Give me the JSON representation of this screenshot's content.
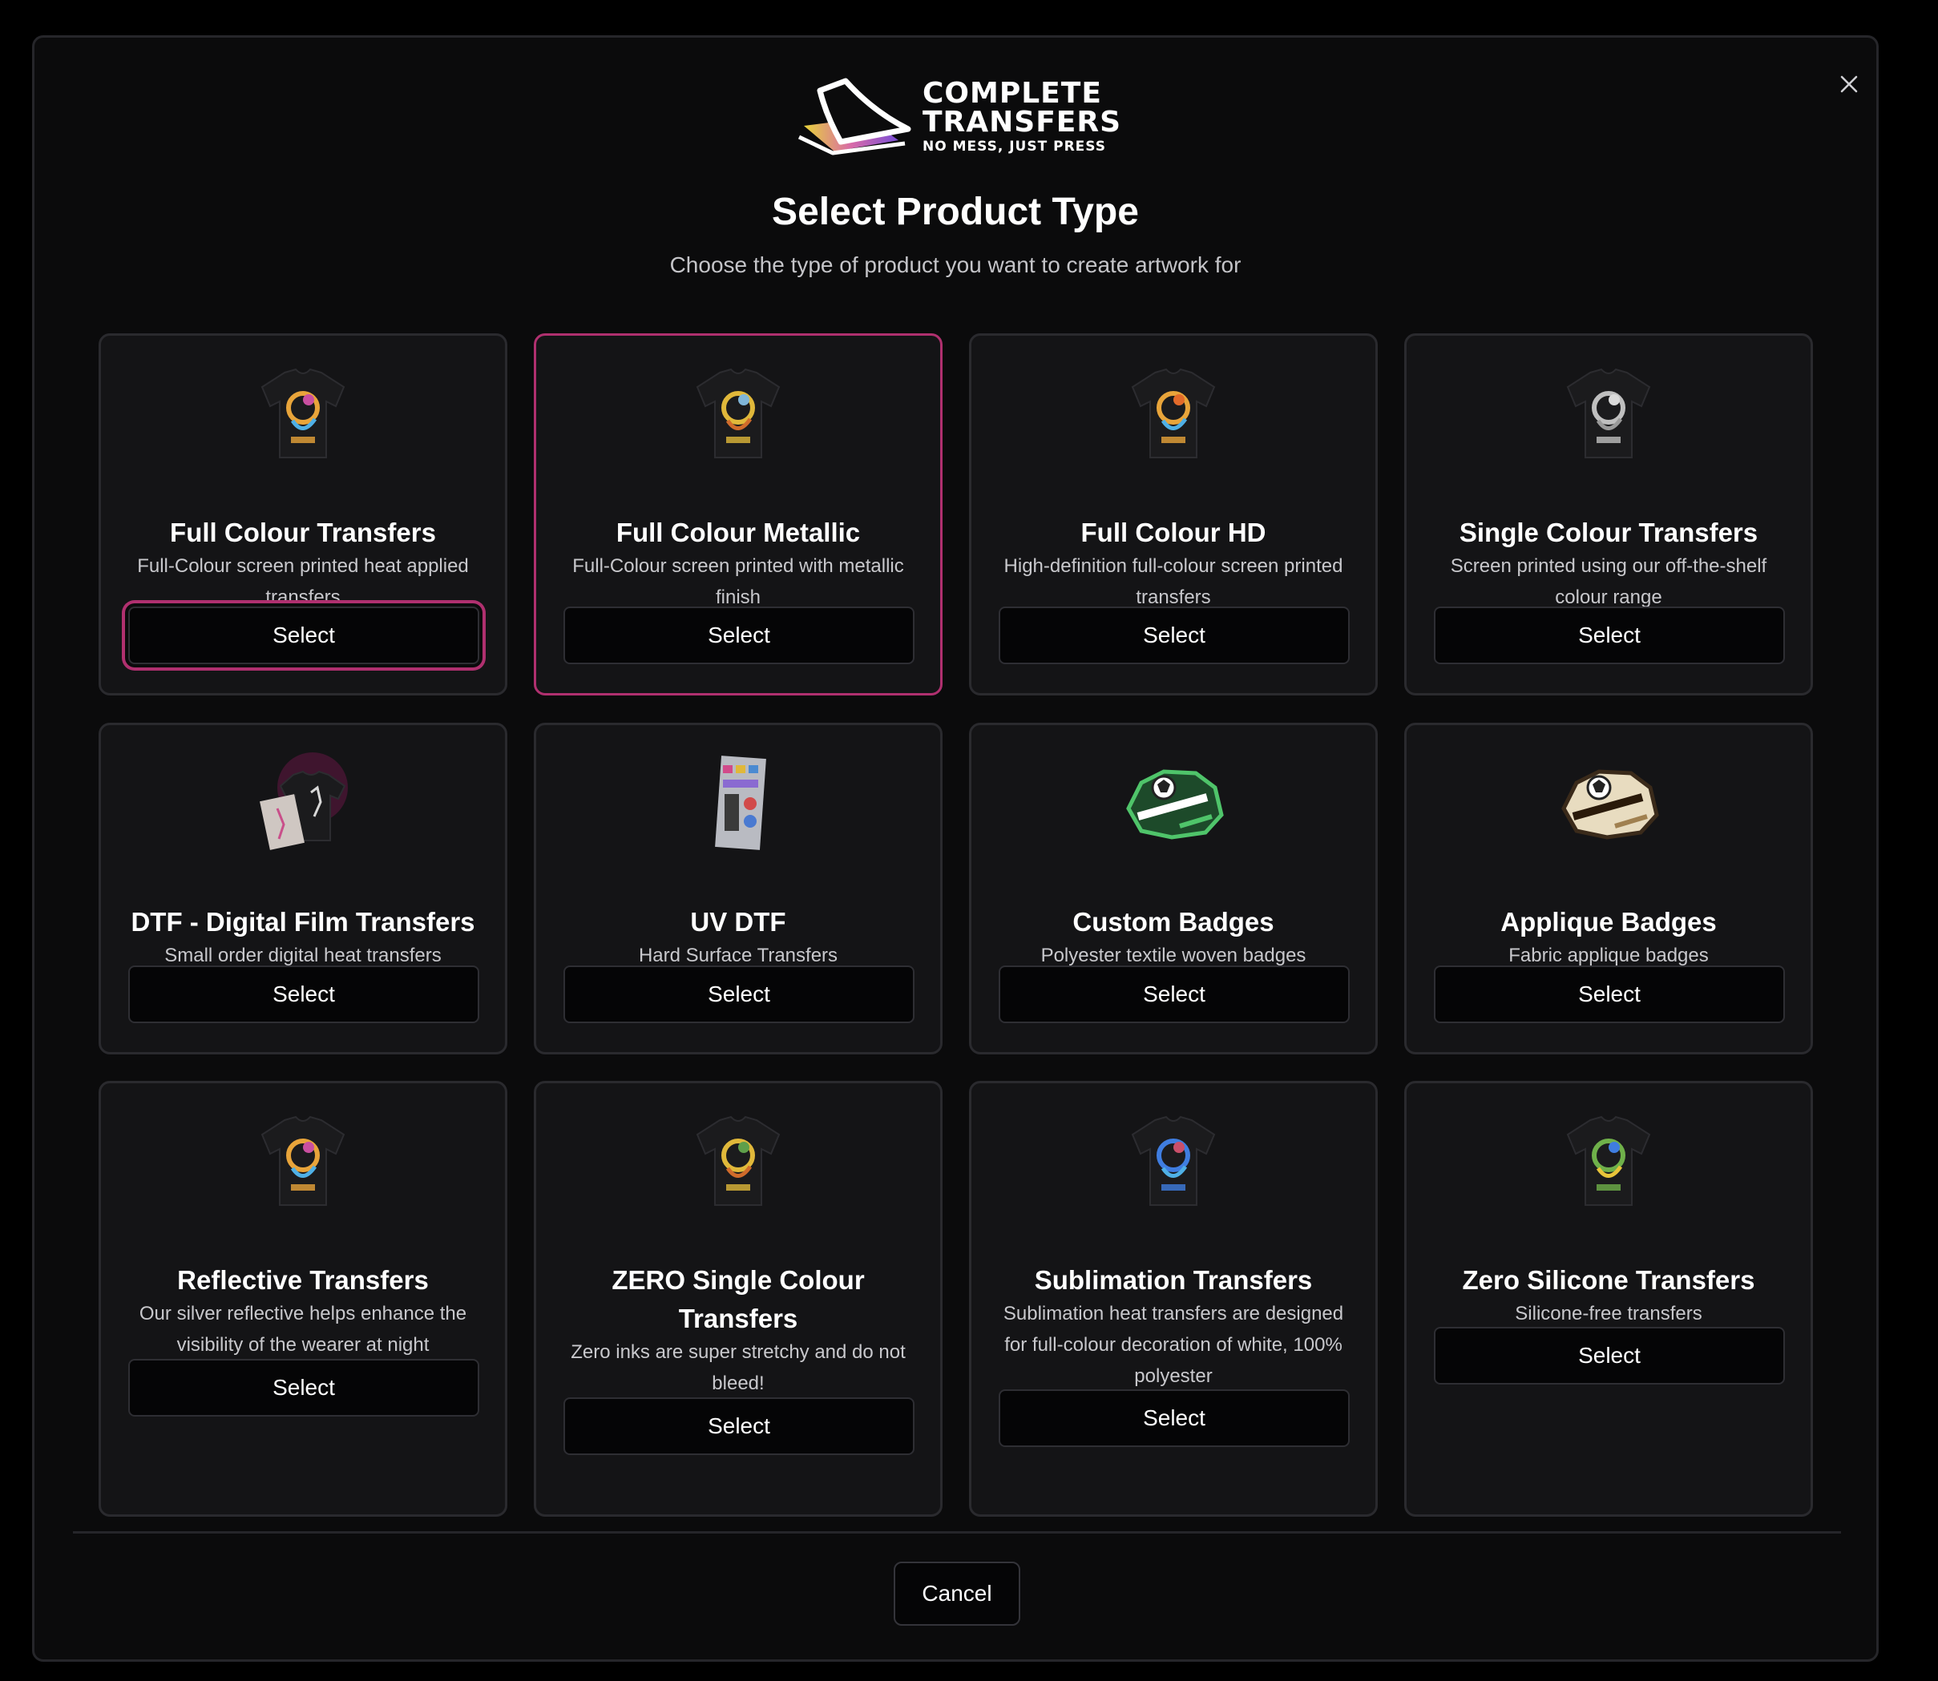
{
  "logo": {
    "line1": "COMPLETE",
    "line2": "TRANSFERS",
    "tagline": "NO MESS, JUST PRESS"
  },
  "dialog": {
    "title": "Select Product Type",
    "subtitle": "Choose the type of product you want to create artwork for",
    "close_icon": "close-icon",
    "cancel_label": "Cancel"
  },
  "products": [
    {
      "name": "Full Colour Transfers",
      "description": "Full-Colour screen printed heat applied transfers",
      "button": "Select",
      "image": "tshirt-icon"
    },
    {
      "name": "Full Colour Metallic",
      "description": "Full-Colour screen printed with metallic finish",
      "button": "Select",
      "image": "tshirt-icon"
    },
    {
      "name": "Full Colour HD",
      "description": "High-definition full-colour screen printed transfers",
      "button": "Select",
      "image": "tshirt-icon"
    },
    {
      "name": "Single Colour Transfers",
      "description": "Screen printed using our off-the-shelf colour range",
      "button": "Select",
      "image": "tshirt-icon"
    },
    {
      "name": "DTF - Digital Film Transfers",
      "description": "Small order digital heat transfers",
      "button": "Select",
      "image": "dtf-film-icon"
    },
    {
      "name": "UV DTF",
      "description": "Hard Surface Transfers",
      "button": "Select",
      "image": "sticker-sheet-icon"
    },
    {
      "name": "Custom Badges",
      "description": "Polyester textile woven badges",
      "button": "Select",
      "image": "badge-icon"
    },
    {
      "name": "Applique Badges",
      "description": "Fabric applique badges",
      "button": "Select",
      "image": "badge-icon"
    },
    {
      "name": "Reflective Transfers",
      "description": "Our silver reflective helps enhance the visibility of the wearer at night",
      "button": "Select",
      "image": "tshirt-icon"
    },
    {
      "name": "ZERO Single Colour Transfers",
      "description": "Zero inks are super stretchy and do not bleed!",
      "button": "Select",
      "image": "tshirt-icon"
    },
    {
      "name": "Sublimation Transfers",
      "description": "Sublimation heat transfers are designed for full-colour decoration of white, 100% polyester",
      "button": "Select",
      "image": "tshirt-icon"
    },
    {
      "name": "Zero Silicone Transfers",
      "description": "Silicone-free transfers",
      "button": "Select",
      "image": "tshirt-icon"
    }
  ],
  "colors": {
    "accent": "#b0306f",
    "background": "#0b0b0c",
    "card": "#141416"
  }
}
